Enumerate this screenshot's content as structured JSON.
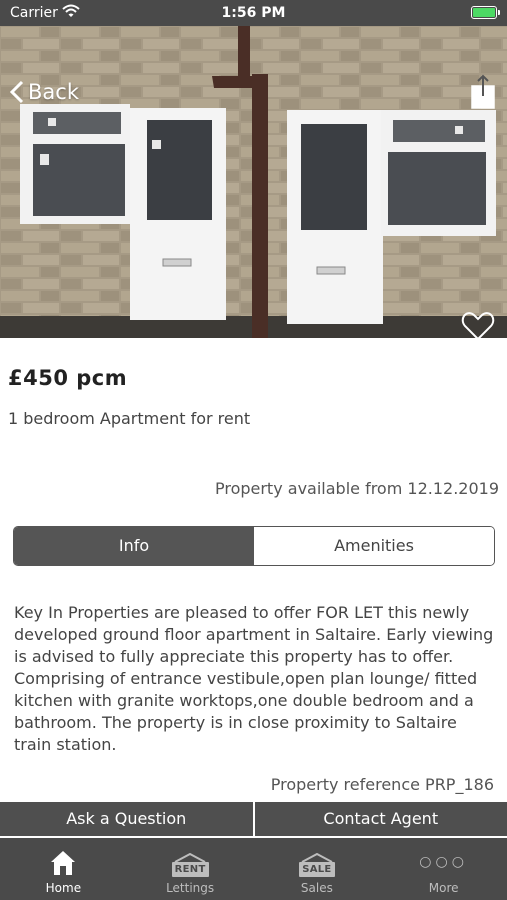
{
  "status_bar": {
    "carrier": "Carrier",
    "time": "1:56 PM"
  },
  "nav": {
    "back_label": "Back"
  },
  "property": {
    "price": "£450 pcm",
    "subtitle": "1 bedroom Apartment for rent",
    "available": "Property available from 12.12.2019",
    "description": "Key In Properties are pleased to offer FOR LET this newly developed ground floor apartment in Saltaire. Early viewing is advised to fully appreciate this property has to offer. Comprising of entrance vestibule,open plan lounge/ fitted kitchen with granite worktops,one double bedroom and a bathroom. The property is in close proximity to Saltaire train station.",
    "reference": "Property reference PRP_186"
  },
  "tabs": [
    {
      "label": "Info",
      "active": true
    },
    {
      "label": "Amenities",
      "active": false
    }
  ],
  "actions": {
    "ask_label": "Ask a Question",
    "contact_label": "Contact Agent"
  },
  "tab_bar": {
    "items": [
      {
        "label": "Home",
        "icon": "home-icon",
        "active": true
      },
      {
        "label": "Lettings",
        "icon": "rent-sign-icon",
        "sign": "RENT"
      },
      {
        "label": "Sales",
        "icon": "sale-sign-icon",
        "sign": "SALE"
      },
      {
        "label": "More",
        "icon": "more-icon",
        "glyph": "○○○"
      }
    ]
  },
  "colors": {
    "bar": "#4a4a4a",
    "button": "#4f4f4f",
    "battery": "#4cd964"
  }
}
